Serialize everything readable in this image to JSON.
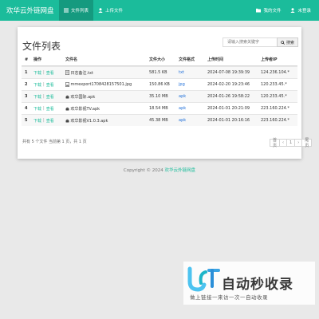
{
  "nav": {
    "brand": "欢华云外链网盘",
    "items": [
      {
        "label": "文件列表",
        "icon": "list-icon",
        "active": true
      },
      {
        "label": "上传文件",
        "icon": "user-icon",
        "active": false
      }
    ],
    "right_items": [
      {
        "label": "我的文件",
        "icon": "folder-icon"
      },
      {
        "label": "未登录",
        "icon": "user-icon"
      }
    ]
  },
  "main": {
    "title": "文件列表",
    "search": {
      "placeholder": "请输入搜索关键字",
      "button_label": "搜索"
    },
    "table": {
      "headers": [
        "#",
        "操作",
        "文件名",
        "文件大小",
        "文件格式",
        "上传时间",
        "上传者IP"
      ],
      "action_download": "下载",
      "action_view": "查看",
      "rows": [
        {
          "num": "1",
          "icon": "text-file-icon",
          "name": "日志备注.txt",
          "size": "581.5 KB",
          "format": "txt",
          "time": "2024-07-08 19:39:39",
          "ip": "124.236.104.*"
        },
        {
          "num": "2",
          "icon": "image-file-icon",
          "name": "mmexport1708428157501.jpg",
          "size": "150.86 KB",
          "format": "jpg",
          "time": "2024-02-20 19:23:46",
          "ip": "120.233.45.*"
        },
        {
          "num": "3",
          "icon": "android-icon",
          "name": "欢华国际.apk",
          "size": "35.10 MB",
          "format": "apk",
          "time": "2024-01-26 19:58:22",
          "ip": "120.233.45.*"
        },
        {
          "num": "4",
          "icon": "android-icon",
          "name": "欢华影视TV.apk",
          "size": "18.54 MB",
          "format": "apk",
          "time": "2024-01-01 20:21:09",
          "ip": "223.160.224.*"
        },
        {
          "num": "5",
          "icon": "android-icon",
          "name": "欢华影视V1.0.3.apk",
          "size": "45.38 MB",
          "format": "apk",
          "time": "2024-01-01 20:16:16",
          "ip": "223.160.224.*"
        }
      ]
    },
    "summary": "共有 5 个文件 当前第 1 页，共 1 页",
    "pager": {
      "prev": "首页",
      "prev_arrow": "‹",
      "current": "1",
      "next_arrow": "›",
      "last": "尾页"
    }
  },
  "footer": {
    "copyright": "Copyright © 2024",
    "link": "欢华云外链网盘"
  },
  "watermark": {
    "title": "自动秒收录",
    "subtitle": "做上链接一来访一次一自动收录"
  },
  "colors": {
    "accent": "#1bbc9b",
    "nav_active": "#159a7f",
    "link_blue": "#1e6fd9"
  }
}
